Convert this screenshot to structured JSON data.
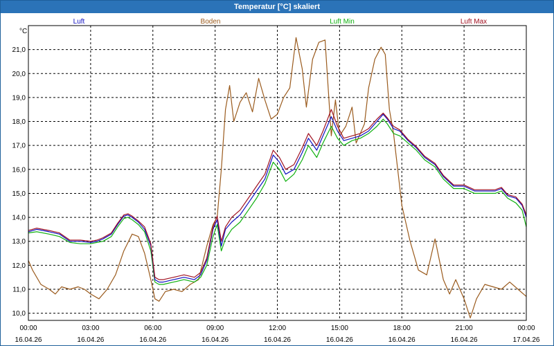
{
  "window": {
    "title": "Temperatur [°C] skaliert"
  },
  "chart_data": {
    "type": "line",
    "title": "Temperatur [°C] skaliert",
    "ylabel": "°C",
    "xlabel": "",
    "ylim": [
      9.7,
      22.0
    ],
    "xlim": [
      0,
      24
    ],
    "grid": true,
    "legend_position": "top",
    "y_ticks": [
      "10,0",
      "11,0",
      "12,0",
      "13,0",
      "14,0",
      "15,0",
      "16,0",
      "17,0",
      "18,0",
      "19,0",
      "20,0",
      "21,0"
    ],
    "x_ticks": [
      {
        "time": "00:00",
        "date": "16.04.26"
      },
      {
        "time": "03:00",
        "date": "16.04.26"
      },
      {
        "time": "06:00",
        "date": "16.04.26"
      },
      {
        "time": "09:00",
        "date": "16.04.26"
      },
      {
        "time": "12:00",
        "date": "16.04.26"
      },
      {
        "time": "15:00",
        "date": "16.04.26"
      },
      {
        "time": "18:00",
        "date": "16.04.26"
      },
      {
        "time": "21:00",
        "date": "16.04.26"
      },
      {
        "time": "00:00",
        "date": "17.04.26"
      }
    ],
    "series": [
      {
        "name": "Luft",
        "color": "#1010c0",
        "x": [
          0,
          0.4,
          1,
          1.5,
          2,
          2.5,
          3,
          3.3,
          3.6,
          4,
          4.3,
          4.6,
          4.8,
          5,
          5.3,
          5.6,
          5.9,
          6.1,
          6.3,
          6.5,
          7,
          7.5,
          8,
          8.3,
          8.6,
          8.9,
          9.1,
          9.3,
          9.5,
          9.8,
          10.2,
          10.6,
          11,
          11.4,
          11.8,
          12.1,
          12.4,
          12.8,
          13.2,
          13.5,
          13.9,
          14.2,
          14.6,
          14.9,
          15.2,
          15.6,
          16,
          16.4,
          16.8,
          17.1,
          17.3,
          17.6,
          17.9,
          18.3,
          18.7,
          19.1,
          19.6,
          20,
          20.5,
          21,
          21.5,
          22,
          22.5,
          22.8,
          23.1,
          23.5,
          23.8,
          24
        ],
        "y": [
          13.4,
          13.5,
          13.4,
          13.3,
          13.0,
          13.0,
          12.95,
          13.0,
          13.1,
          13.3,
          13.7,
          14.05,
          14.1,
          14.0,
          13.8,
          13.5,
          12.8,
          11.4,
          11.3,
          11.3,
          11.4,
          11.5,
          11.4,
          11.6,
          12.2,
          13.5,
          13.9,
          12.8,
          13.5,
          13.8,
          14.1,
          14.6,
          15.1,
          15.6,
          16.6,
          16.3,
          15.8,
          16.0,
          16.7,
          17.3,
          16.8,
          17.4,
          18.2,
          17.6,
          17.2,
          17.3,
          17.4,
          17.6,
          18.0,
          18.3,
          18.1,
          17.7,
          17.6,
          17.2,
          16.9,
          16.5,
          16.2,
          15.7,
          15.3,
          15.3,
          15.1,
          15.1,
          15.1,
          15.2,
          14.9,
          14.8,
          14.5,
          14.0
        ]
      },
      {
        "name": "Boden",
        "color": "#9a5a1c",
        "x": [
          0,
          0.2,
          0.6,
          1,
          1.3,
          1.6,
          2,
          2.4,
          2.7,
          3,
          3.4,
          3.8,
          4.2,
          4.6,
          5,
          5.3,
          5.6,
          5.9,
          6.1,
          6.3,
          6.6,
          7,
          7.4,
          7.8,
          8.2,
          8.6,
          8.9,
          9.1,
          9.3,
          9.5,
          9.7,
          9.9,
          10.2,
          10.5,
          10.8,
          11.1,
          11.4,
          11.7,
          12,
          12.3,
          12.6,
          12.9,
          13.2,
          13.4,
          13.7,
          14,
          14.3,
          14.6,
          14.8,
          15,
          15.3,
          15.6,
          15.8,
          16,
          16.2,
          16.4,
          16.7,
          17,
          17.2,
          17.4,
          17.6,
          18,
          18.4,
          18.8,
          19.2,
          19.6,
          20,
          20.3,
          20.6,
          21,
          21.3,
          21.6,
          22,
          22.4,
          22.8,
          23.2,
          23.6,
          24
        ],
        "y": [
          12.2,
          11.8,
          11.2,
          11.0,
          10.8,
          11.1,
          11.0,
          11.1,
          11.0,
          10.8,
          10.6,
          11.0,
          11.6,
          12.6,
          13.3,
          13.2,
          12.5,
          11.4,
          10.6,
          10.5,
          10.9,
          11.0,
          10.9,
          11.2,
          11.4,
          12.8,
          13.7,
          14.0,
          16.0,
          18.5,
          19.5,
          18.0,
          18.8,
          19.2,
          18.4,
          19.8,
          18.9,
          18.1,
          18.3,
          19.0,
          19.4,
          21.5,
          20.2,
          18.6,
          20.6,
          21.3,
          21.4,
          17.4,
          18.9,
          17.4,
          17.8,
          18.6,
          17.1,
          17.5,
          17.9,
          19.4,
          20.6,
          21.1,
          20.8,
          18.5,
          17.5,
          14.5,
          13.0,
          11.8,
          11.6,
          13.1,
          11.4,
          10.8,
          11.4,
          10.6,
          9.8,
          10.6,
          11.2,
          11.1,
          11.0,
          11.3,
          11.0,
          10.7
        ]
      },
      {
        "name": "Luft Min",
        "color": "#10b010",
        "x": [
          0,
          0.4,
          1,
          1.5,
          2,
          2.5,
          3,
          3.3,
          3.6,
          4,
          4.3,
          4.6,
          4.8,
          5,
          5.3,
          5.6,
          5.9,
          6.1,
          6.3,
          6.5,
          7,
          7.5,
          8,
          8.3,
          8.6,
          8.9,
          9.1,
          9.3,
          9.5,
          9.8,
          10.2,
          10.6,
          11,
          11.4,
          11.8,
          12.1,
          12.4,
          12.8,
          13.2,
          13.5,
          13.9,
          14.2,
          14.6,
          14.9,
          15.2,
          15.6,
          16,
          16.4,
          16.8,
          17.1,
          17.3,
          17.6,
          17.9,
          18.3,
          18.7,
          19.1,
          19.6,
          20,
          20.5,
          21,
          21.5,
          22,
          22.5,
          22.8,
          23.1,
          23.5,
          23.8,
          24
        ],
        "y": [
          13.35,
          13.4,
          13.3,
          13.2,
          12.95,
          12.9,
          12.9,
          12.95,
          13.0,
          13.2,
          13.6,
          13.95,
          14.0,
          13.9,
          13.7,
          13.4,
          12.6,
          11.3,
          11.2,
          11.2,
          11.3,
          11.4,
          11.3,
          11.5,
          12.0,
          13.2,
          13.7,
          12.6,
          13.1,
          13.5,
          13.8,
          14.3,
          14.8,
          15.4,
          16.3,
          16.0,
          15.5,
          15.8,
          16.4,
          17.0,
          16.5,
          17.1,
          17.8,
          17.3,
          17.0,
          17.2,
          17.3,
          17.5,
          17.8,
          18.1,
          17.9,
          17.5,
          17.4,
          17.1,
          16.8,
          16.4,
          16.1,
          15.6,
          15.2,
          15.2,
          15.0,
          15.0,
          15.0,
          15.1,
          14.8,
          14.6,
          14.3,
          13.6
        ]
      },
      {
        "name": "Luft Max",
        "color": "#a01020",
        "x": [
          0,
          0.4,
          1,
          1.5,
          2,
          2.5,
          3,
          3.3,
          3.6,
          4,
          4.3,
          4.6,
          4.8,
          5,
          5.3,
          5.6,
          5.9,
          6.1,
          6.3,
          6.5,
          7,
          7.5,
          8,
          8.3,
          8.6,
          8.9,
          9.1,
          9.3,
          9.5,
          9.8,
          10.2,
          10.6,
          11,
          11.4,
          11.8,
          12.1,
          12.4,
          12.8,
          13.2,
          13.5,
          13.9,
          14.2,
          14.6,
          14.9,
          15.2,
          15.6,
          16,
          16.4,
          16.8,
          17.1,
          17.3,
          17.6,
          17.9,
          18.3,
          18.7,
          19.1,
          19.6,
          20,
          20.5,
          21,
          21.5,
          22,
          22.5,
          22.8,
          23.1,
          23.5,
          23.8,
          24
        ],
        "y": [
          13.45,
          13.55,
          13.45,
          13.35,
          13.05,
          13.05,
          13.0,
          13.05,
          13.15,
          13.35,
          13.75,
          14.1,
          14.15,
          14.05,
          13.85,
          13.6,
          12.9,
          11.5,
          11.4,
          11.4,
          11.5,
          11.6,
          11.5,
          11.7,
          12.3,
          13.6,
          14.05,
          13.0,
          13.6,
          14.0,
          14.3,
          14.8,
          15.3,
          15.8,
          16.8,
          16.5,
          16.0,
          16.2,
          16.9,
          17.5,
          17.0,
          17.6,
          18.5,
          17.8,
          17.3,
          17.4,
          17.5,
          17.7,
          18.1,
          18.35,
          18.15,
          17.8,
          17.65,
          17.25,
          16.95,
          16.55,
          16.25,
          15.75,
          15.35,
          15.35,
          15.15,
          15.15,
          15.15,
          15.25,
          14.95,
          14.85,
          14.55,
          14.1
        ]
      }
    ]
  }
}
